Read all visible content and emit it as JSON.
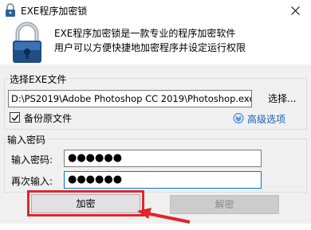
{
  "window": {
    "title": "EXE程序加密锁",
    "close_symbol": "×"
  },
  "header": {
    "line1": "EXE程序加密锁是一款专业的程序加密软件",
    "line2": "用户可以方便快捷地加密程序并设定运行权限",
    "icon": "padlock-icon"
  },
  "file_group": {
    "label": "选择EXE文件",
    "path_value": "D:\\PS2019\\Adobe Photoshop CC 2019\\Photoshop.exe",
    "browse_label": "选择...",
    "backup_label": "备份原文件",
    "backup_checked": true,
    "advanced_label": "高级选项"
  },
  "password_group": {
    "label": "输入密码",
    "password_label": "输入密码:",
    "confirm_label": "再次输入:",
    "password_masked": "●●●●●●",
    "confirm_masked": "●●●●●●"
  },
  "buttons": {
    "encrypt_label": "加密",
    "decrypt_label": "解密"
  },
  "colors": {
    "highlight_red": "#e0262b",
    "link_blue": "#1b5fb8",
    "focus_blue": "#0078d7"
  }
}
